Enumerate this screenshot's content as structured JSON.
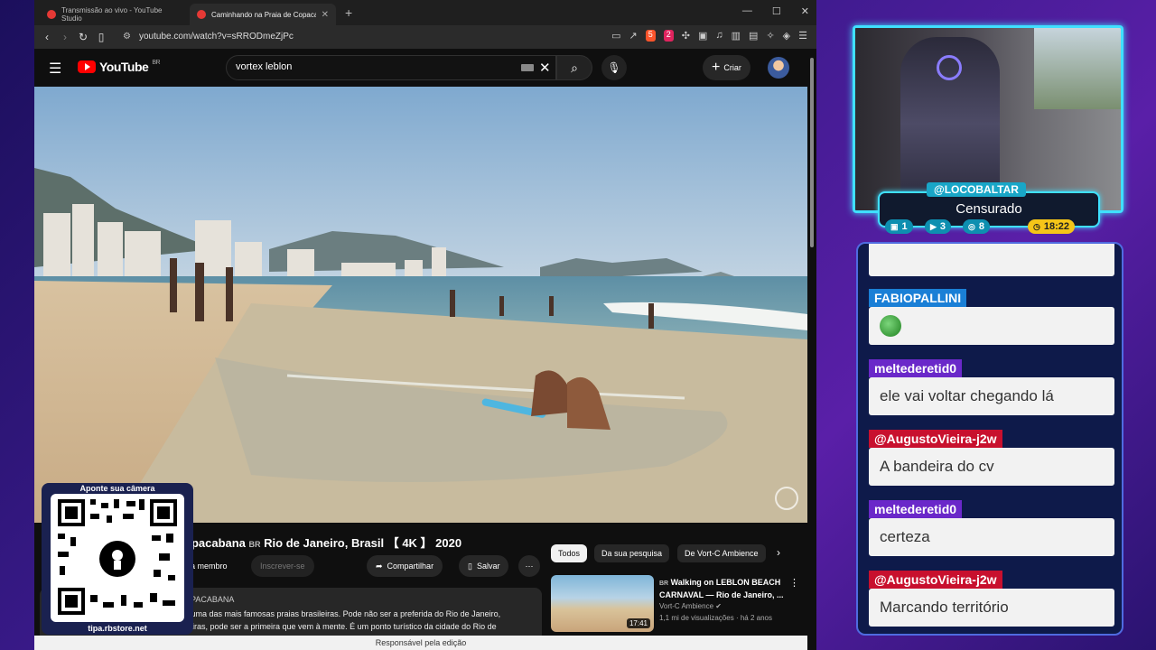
{
  "browser": {
    "tabs": [
      {
        "label": "Transmissão ao vivo - YouTube Studio",
        "active": false
      },
      {
        "label": "Caminhando na Praia de Copacaba",
        "active": true
      }
    ],
    "url": "youtube.com/watch?v=sRRODmeZjPc",
    "ext_brave_badge": "5",
    "ext_red_badge": "2"
  },
  "youtube": {
    "logo_text": "YouTube",
    "logo_region": "BR",
    "search_value": "vortex leblon",
    "create_label": "Criar"
  },
  "video": {
    "title_prefix": "opacabana",
    "title_flag": "BR",
    "title_rest": "Rio de Janeiro, Brasil 【 4K 】 2020",
    "member_label": "eja membro",
    "subscribe_label": "Inscrever-se",
    "share_label": "Compartilhar",
    "save_label": "Salvar",
    "desc_head": "OPACABANA",
    "desc_line1": "a uma das mais famosas praias brasileiras. Pode não ser a preferida do Rio de Janeiro,",
    "desc_line2": "ileiras, pode ser a primeira que vem à mente. É um ponto turístico da cidade do Rio de"
  },
  "chips": [
    "Todos",
    "Da sua pesquisa",
    "De Vort-C Ambience"
  ],
  "recommendation": {
    "title_flag": "BR",
    "title": "Walking on LEBLON BEACH CARNAVAL — Rio de Janeiro, ...",
    "channel": "Vort-C Ambience",
    "views": "1,1 mi de visualizações",
    "age": "há 2 anos",
    "duration": "17:41"
  },
  "statusbar": "Responsável pela edição",
  "qr": {
    "top": "Aponte sua câmera",
    "bottom": "tipa.rbstore.net"
  },
  "streamer": {
    "name": "@LOCOBALTAR",
    "subtitle": "Censurado",
    "stats": {
      "twitch": "1",
      "youtube": "3",
      "kick": "8",
      "time": "18:22"
    }
  },
  "chat": [
    {
      "user": "FABIOPALLINI",
      "text": "",
      "emote": "pepe",
      "name_color": "#1a7fd6"
    },
    {
      "user": "meltederetid0",
      "text": "ele vai voltar chegando lá",
      "name_color": "#6a28c9"
    },
    {
      "user": "@AugustoVieira-j2w",
      "text": "A bandeira do cv",
      "name_color": "#c8102e"
    },
    {
      "user": "meltederetid0",
      "text": "certeza",
      "name_color": "#6a28c9"
    },
    {
      "user": "@AugustoVieira-j2w",
      "text": "Marcando território",
      "name_color": "#c8102e"
    }
  ],
  "colors": {
    "youtube_red": "#ff0000",
    "overlay_cyan": "#3fe0ff",
    "chat_panel": "#0e1a4a"
  }
}
